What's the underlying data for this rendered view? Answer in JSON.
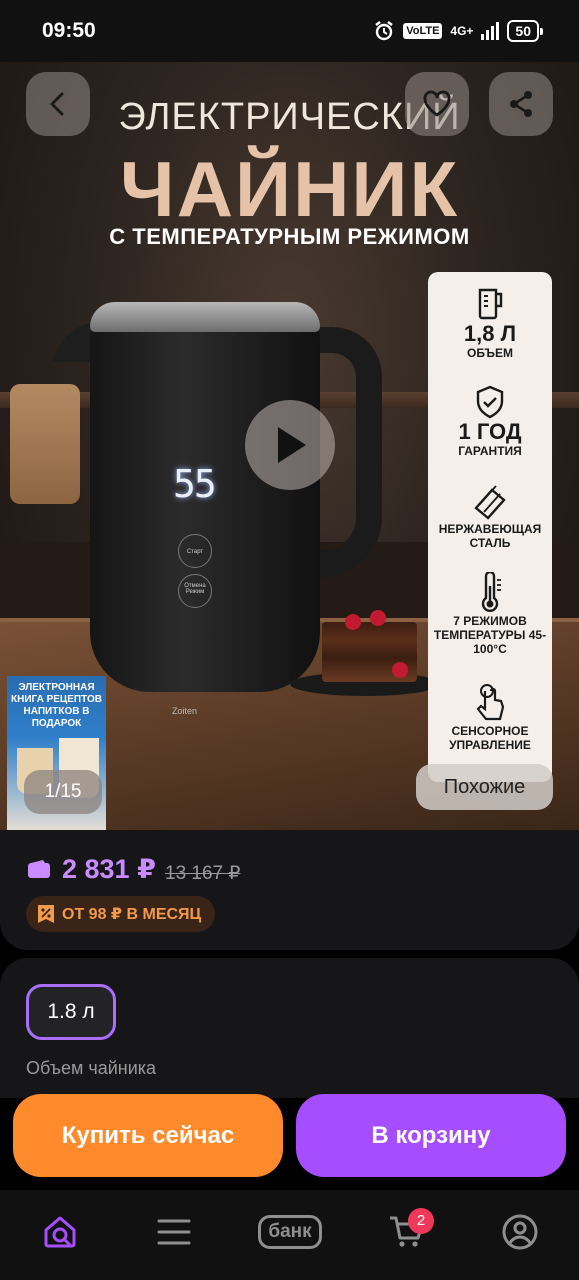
{
  "status_bar": {
    "time": "09:50",
    "network_label": "4G+",
    "volte_label": "VoLTE",
    "battery": "50"
  },
  "gallery": {
    "headline_line1": "ЭЛЕКТРИЧЕСКИЙ",
    "headline_line2": "ЧАЙНИК",
    "headline_line3": "С ТЕМПЕРАТУРНЫМ РЕЖИМОМ",
    "display_value": "55",
    "kettle_buttons": [
      "Старт Отмена",
      "Режим"
    ],
    "brand": "Zoiten",
    "features": [
      {
        "icon": "jug-icon",
        "big": "1,8 Л",
        "small": "ОБЪЕМ"
      },
      {
        "icon": "shield-check-icon",
        "big": "1 ГОД",
        "small": "ГАРАНТИЯ"
      },
      {
        "icon": "steel-roll-icon",
        "big": "",
        "small": "НЕРЖАВЕЮЩАЯ СТАЛЬ"
      },
      {
        "icon": "thermometer-icon",
        "big": "",
        "small": "7 РЕЖИМОВ ТЕМПЕРАТУРЫ 45-100°С"
      },
      {
        "icon": "touch-hand-icon",
        "big": "",
        "small": "СЕНСОРНОЕ УПРАВЛЕНИЕ"
      }
    ],
    "promo_text": "ЭЛЕКТРОННАЯ КНИГА РЕЦЕПТОВ НАПИТКОВ В ПОДАРОК",
    "counter": "1/15",
    "similar_label": "Похожие"
  },
  "price": {
    "current": "2 831 ₽",
    "old": "13 167 ₽",
    "installment": "ОТ 98 ₽ В МЕСЯЦ",
    "accent_color": "#c98bff"
  },
  "option": {
    "selected": "1.8 л",
    "label": "Объем чайника"
  },
  "actions": {
    "buy_now": "Купить сейчас",
    "add_to_cart": "В корзину",
    "buy_color": "#ff8a2b",
    "cart_color": "#a64dff"
  },
  "bottom_nav": {
    "bank_label": "банк",
    "cart_count": "2"
  }
}
